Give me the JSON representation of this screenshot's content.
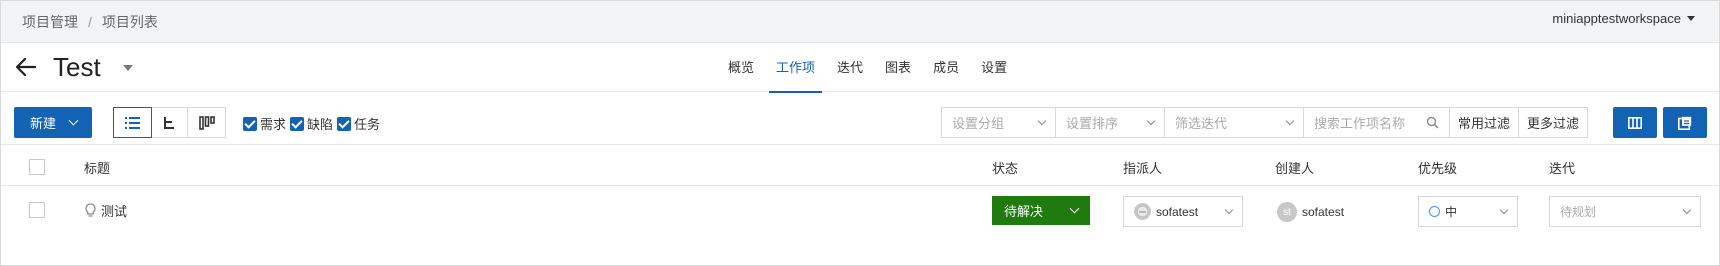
{
  "breadcrumb": {
    "items": [
      "项目管理",
      "项目列表"
    ],
    "separator": "/"
  },
  "workspace": {
    "name": "miniapptestworkspace"
  },
  "project": {
    "name": "Test"
  },
  "tabs": [
    {
      "label": "概览"
    },
    {
      "label": "工作项",
      "active": true
    },
    {
      "label": "迭代"
    },
    {
      "label": "图表"
    },
    {
      "label": "成员"
    },
    {
      "label": "设置"
    }
  ],
  "toolbar": {
    "new_label": "新建",
    "checks": [
      {
        "label": "需求",
        "checked": true
      },
      {
        "label": "缺陷",
        "checked": true
      },
      {
        "label": "任务",
        "checked": true
      }
    ],
    "filters": {
      "group_placeholder": "设置分组",
      "sort_placeholder": "设置排序",
      "iteration_placeholder": "筛选迭代",
      "search_placeholder": "搜索工作项名称",
      "common_filter": "常用过滤",
      "more_filter": "更多过滤"
    }
  },
  "table": {
    "headers": {
      "title": "标题",
      "status": "状态",
      "assignee": "指派人",
      "creator": "创建人",
      "priority": "优先级",
      "iteration": "迭代"
    },
    "rows": [
      {
        "title": "测试",
        "status": "待解决",
        "assignee": "sofatest",
        "creator": "sofatest",
        "creator_initials": "st",
        "priority": "中",
        "iteration": "待规划"
      }
    ]
  },
  "colors": {
    "primary": "#1363b5",
    "status_green": "#1f7b0e",
    "priority_ring": "#3d9ae8"
  },
  "icons": [
    "back-arrow-icon",
    "list-view-icon",
    "tree-view-icon",
    "board-view-icon",
    "search-icon",
    "columns-icon",
    "export-icon",
    "bulb-icon",
    "chevron-down-icon"
  ]
}
